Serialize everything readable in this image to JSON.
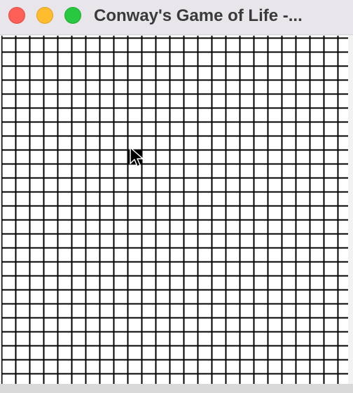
{
  "window": {
    "title": "Conway's Game of Life -..."
  },
  "controls": {
    "close_icon": "close-icon",
    "minimize_icon": "minimize-icon",
    "zoom_icon": "zoom-icon"
  },
  "grid": {
    "columns": 25,
    "rows": 25,
    "line_color": "#000000",
    "cell_color": "#ffffff",
    "live_color": "#000000",
    "live_cells": [
      {
        "row": 8,
        "col": 9
      }
    ]
  },
  "colors": {
    "close": "#fe5f57",
    "minimize": "#febc2e",
    "zoom": "#28c840",
    "titlebar": "#e8e6ea"
  },
  "cursor": {
    "icon": "arrow-cursor-icon"
  }
}
